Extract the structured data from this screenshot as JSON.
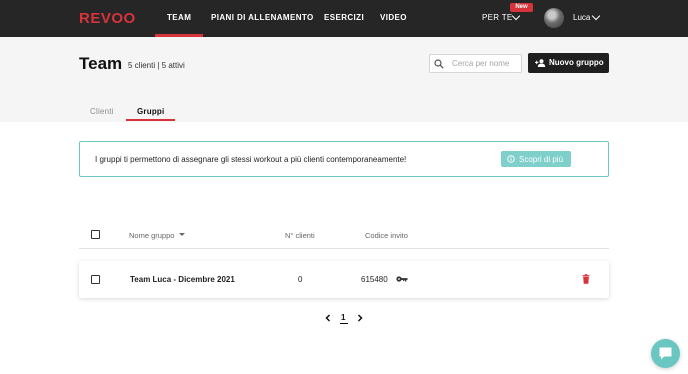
{
  "brand": {
    "logo": "REVOO",
    "accent": "#d6333b"
  },
  "nav": {
    "items": [
      {
        "label": "TEAM"
      },
      {
        "label": "PIANI DI ALLENAMENTO"
      },
      {
        "label": "ESERCIZI"
      },
      {
        "label": "VIDEO"
      }
    ],
    "perte_label": "PER TE",
    "new_badge": "New",
    "user_name": "Luca"
  },
  "header": {
    "title": "Team",
    "subtitle": "5 clienti | 5 attivi",
    "search_placeholder": "Cerca per nome",
    "new_group_label": "Nuovo gruppo",
    "tabs": [
      {
        "label": "Clienti"
      },
      {
        "label": "Gruppi"
      }
    ]
  },
  "banner": {
    "text": "I gruppi ti permettono di assegnare gli stessi workout a più clienti contemporaneamente!",
    "button_label": "Scopri di più",
    "border_color": "#6ec8c4"
  },
  "table": {
    "columns": [
      "Nome gruppo",
      "N° clienti",
      "Codice invito"
    ],
    "rows": [
      {
        "name": "Team Luca - Dicembre 2021",
        "clients": "0",
        "invite_code": "615480"
      }
    ]
  },
  "pagination": {
    "current": "1"
  },
  "icons": [
    "chevron-down-icon",
    "search-icon",
    "add-user-icon",
    "info-icon",
    "sort-down-icon",
    "key-icon",
    "trash-icon",
    "chevron-left-icon",
    "chevron-right-icon",
    "chat-icon"
  ]
}
